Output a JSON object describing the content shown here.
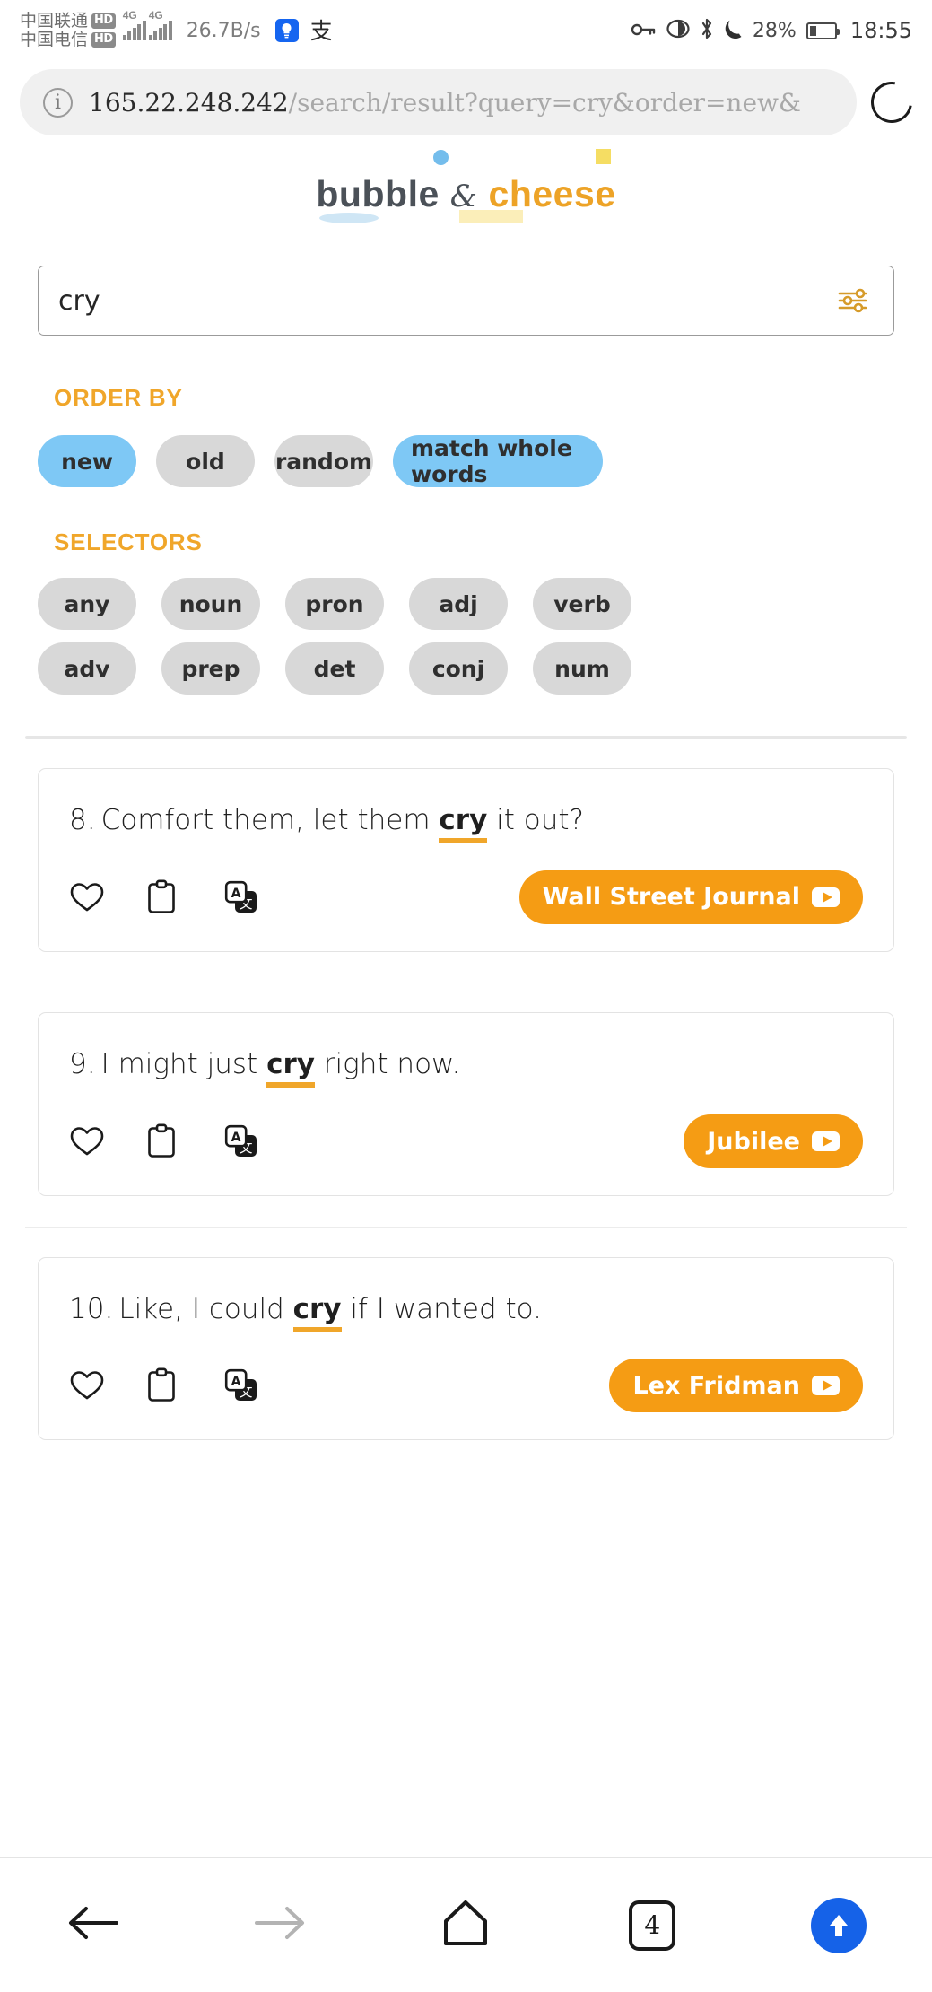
{
  "status_bar": {
    "carrier_1": "中国联通",
    "carrier_2": "中国电信",
    "hd_badge": "HD",
    "net_label_1": "4G",
    "net_label_2": "4G",
    "network_speed": "26.7B/s",
    "app_icon_1": "lightbulb-icon",
    "app_icon_2": "支",
    "key_icon": "key-icon",
    "eye_icon": "eye-icon",
    "bluetooth_icon": "bluetooth-icon",
    "moon_icon": "moon-icon",
    "battery_percent": "28%",
    "time": "18:55"
  },
  "browser": {
    "url_host": "165.22.248.242",
    "url_path": "/search/result?query=cry&order=new&",
    "info_icon": "info-icon",
    "reload_icon": "reload-icon"
  },
  "logo": {
    "word_1": "bubble",
    "amp": "&",
    "word_2": "cheese",
    "color_word_1": "#4b5158",
    "color_word_2": "#eda327",
    "dot_color": "#74bdec",
    "square_color": "#f5dd63"
  },
  "search": {
    "value": "cry",
    "filter_icon": "sliders-icon"
  },
  "order_by": {
    "label": "ORDER BY",
    "options": [
      {
        "label": "new",
        "active": true
      },
      {
        "label": "old",
        "active": false
      },
      {
        "label": "random",
        "active": false
      },
      {
        "label": "match whole words",
        "active": true
      }
    ]
  },
  "selectors": {
    "label": "SELECTORS",
    "row_1": [
      {
        "label": "any",
        "active": false
      },
      {
        "label": "noun",
        "active": false
      },
      {
        "label": "pron",
        "active": false
      },
      {
        "label": "adj",
        "active": false
      },
      {
        "label": "verb",
        "active": false
      }
    ],
    "row_2": [
      {
        "label": "adv",
        "active": false
      },
      {
        "label": "prep",
        "active": false
      },
      {
        "label": "det",
        "active": false
      },
      {
        "label": "conj",
        "active": false
      },
      {
        "label": "num",
        "active": false
      }
    ]
  },
  "results": [
    {
      "number": "8.",
      "text_before": "Comfort them, let them ",
      "highlight": "cry",
      "text_after": " it out?",
      "source": "Wall Street Journal",
      "actions": [
        "heart-icon",
        "clipboard-icon",
        "translate-icon"
      ]
    },
    {
      "number": "9.",
      "text_before": "I might just ",
      "highlight": "cry",
      "text_after": " right now.",
      "source": "Jubilee",
      "actions": [
        "heart-icon",
        "clipboard-icon",
        "translate-icon"
      ]
    },
    {
      "number": "10.",
      "text_before": "Like, I could ",
      "highlight": "cry",
      "text_after": " if I wanted to.",
      "source": "Lex Fridman",
      "actions": [
        "heart-icon",
        "clipboard-icon",
        "translate-icon"
      ]
    }
  ],
  "bottom_nav": {
    "back": "back-arrow-icon",
    "forward": "forward-arrow-icon",
    "home": "home-icon",
    "tab_count": "4",
    "scroll_up": "scroll-up-icon"
  },
  "colors": {
    "accent_orange": "#f0a62a",
    "badge_orange": "#f59c14",
    "active_blue": "#7ec8f5",
    "pill_gray": "#d8d8d8",
    "nav_blue": "#1562e8"
  }
}
